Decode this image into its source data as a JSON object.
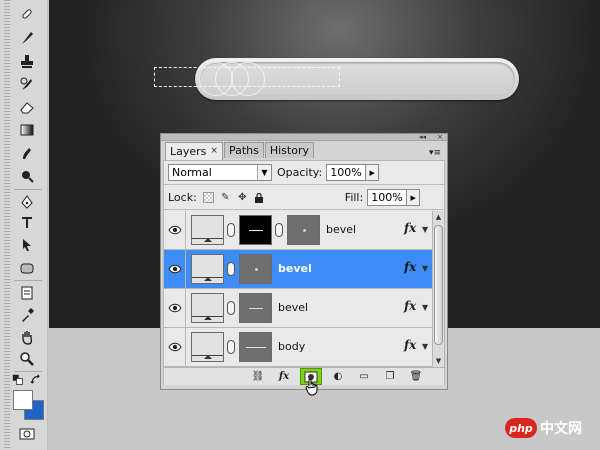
{
  "panel": {
    "tabs": [
      {
        "label": "Layers",
        "close": "×"
      },
      {
        "label": "Paths"
      },
      {
        "label": "History"
      }
    ],
    "menu_glyph": "▾≡",
    "blend_mode": "Normal",
    "opacity_label": "Opacity:",
    "opacity_value": "100%",
    "lock_label": "Lock:",
    "fill_label": "Fill:",
    "fill_value": "100%"
  },
  "layers": [
    {
      "name": "bevel",
      "selected": false,
      "fx": "fx"
    },
    {
      "name": "bevel",
      "selected": true,
      "fx": "fx"
    },
    {
      "name": "bevel",
      "selected": false,
      "fx": "fx"
    },
    {
      "name": "body",
      "selected": false,
      "fx": "fx"
    }
  ],
  "footer": {
    "fx_label": "fx"
  },
  "watermark": {
    "badge": "php",
    "text": "中文网"
  },
  "colors": {
    "selection": "#3e8cf5",
    "highlight_button": "#7ccf1a",
    "background_swatch": "#1f63c6"
  }
}
